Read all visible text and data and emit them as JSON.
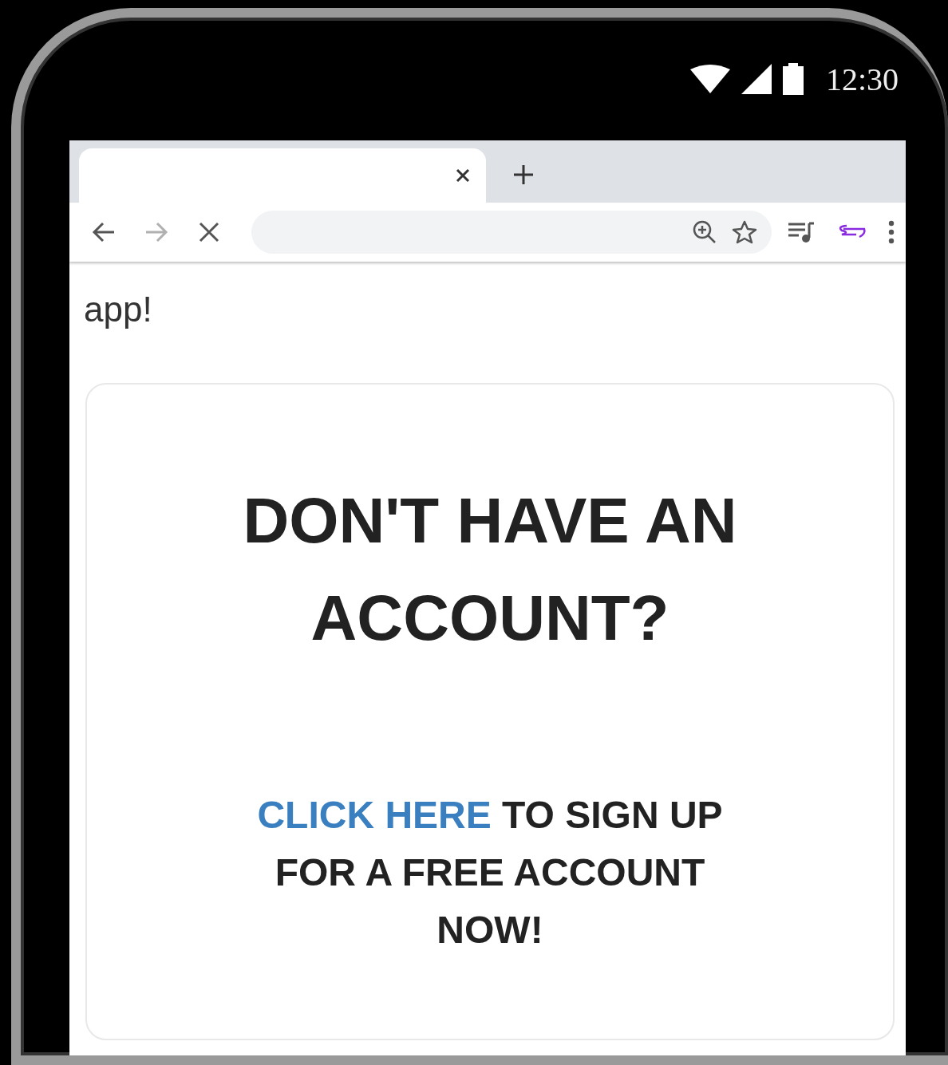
{
  "status_bar": {
    "time": "12:30"
  },
  "browser": {
    "tabs": [
      {
        "selected": true
      }
    ],
    "nav": [
      {
        "kind": "back",
        "disabled": false
      },
      {
        "kind": "forward",
        "disabled": true
      },
      {
        "kind": "stop",
        "disabled": false
      }
    ]
  },
  "page": {
    "intro_tail": "app!",
    "card": {
      "heading": "DON'T HAVE AN ACCOUNT?",
      "link": "CLICK HERE",
      "text": "TO SIGN UP FOR A FREE ACCOUNT NOW!"
    }
  }
}
